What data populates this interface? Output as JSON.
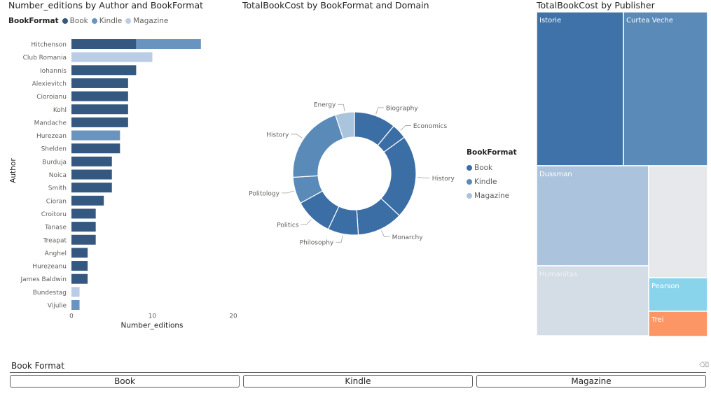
{
  "colors": {
    "book": "#34587f",
    "kindle": "#6a94c0",
    "magazine": "#bbcde4",
    "tm_light": "#e6e8eb",
    "tm_pearson": "#8ad4eb",
    "tm_trei": "#fd9665"
  },
  "bar_chart": {
    "title": "Number_editions by Author and BookFormat",
    "legend_title": "BookFormat",
    "legend_items": [
      "Book",
      "Kindle",
      "Magazine"
    ],
    "xlabel": "Number_editions",
    "ylabel": "Author"
  },
  "donut_chart": {
    "title": "TotalBookCost by BookFormat and Domain",
    "legend_title": "BookFormat",
    "legend_items": [
      "Book",
      "Kindle",
      "Magazine"
    ]
  },
  "treemap": {
    "title": "TotalBookCost by Publisher"
  },
  "slicer": {
    "title": "Book Format",
    "buttons": [
      "Book",
      "Kindle",
      "Magazine"
    ]
  },
  "chart_data": [
    {
      "type": "bar",
      "orientation": "horizontal",
      "stacked": true,
      "title": "Number_editions by Author and BookFormat",
      "xlabel": "Number_editions",
      "ylabel": "Author",
      "xlim": [
        0,
        20
      ],
      "xticks": [
        0,
        10,
        20
      ],
      "legend": "top-left",
      "categories": [
        "Hitchenson",
        "Club Romania",
        "Iohannis",
        "Alexievitch",
        "Cioroianu",
        "Kohl",
        "Mandache",
        "Hurezean",
        "Shelden",
        "Burduja",
        "Noica",
        "Smith",
        "Cioran",
        "Croitoru",
        "Tanase",
        "Treapat",
        "Anghel",
        "Hurezeanu",
        "James Baldwin",
        "Bundestag",
        "Vijulie"
      ],
      "series": [
        {
          "name": "Book",
          "values": [
            8,
            0,
            8,
            7,
            7,
            7,
            7,
            0,
            6,
            5,
            5,
            5,
            4,
            3,
            3,
            3,
            2,
            2,
            2,
            0,
            0
          ]
        },
        {
          "name": "Kindle",
          "values": [
            8,
            0,
            0,
            0,
            0,
            0,
            0,
            6,
            0,
            0,
            0,
            0,
            0,
            0,
            0,
            0,
            0,
            0,
            0,
            0,
            1
          ]
        },
        {
          "name": "Magazine",
          "values": [
            0,
            10,
            0,
            0,
            0,
            0,
            0,
            0,
            0,
            0,
            0,
            0,
            0,
            0,
            0,
            0,
            0,
            0,
            0,
            1,
            0
          ]
        }
      ]
    },
    {
      "type": "pie",
      "donut": true,
      "title": "TotalBookCost by BookFormat and Domain",
      "legend": "right",
      "slices": [
        {
          "label": "Biography",
          "format": "Book",
          "value": 11
        },
        {
          "label": "Economics",
          "format": "Book",
          "value": 4
        },
        {
          "label": "History",
          "format": "Book",
          "value": 22
        },
        {
          "label": "Monarchy",
          "format": "Book",
          "value": 12
        },
        {
          "label": "Philosophy",
          "format": "Book",
          "value": 8
        },
        {
          "label": "Politics",
          "format": "Book",
          "value": 10
        },
        {
          "label": "Politology",
          "format": "Kindle",
          "value": 7
        },
        {
          "label": "History",
          "format": "Kindle",
          "value": 21
        },
        {
          "label": "Energy",
          "format": "Magazine",
          "value": 5
        }
      ]
    },
    {
      "type": "treemap",
      "title": "TotalBookCost by Publisher",
      "items": [
        {
          "label": "Istorie",
          "value": 15
        },
        {
          "label": "Curtea Veche",
          "value": 15
        },
        {
          "label": "Dussman",
          "value": 17
        },
        {
          "label": "Humanitas",
          "value": 11
        },
        {
          "label": "",
          "value": 14
        },
        {
          "label": "Pearson",
          "value": 3
        },
        {
          "label": "Trei",
          "value": 3
        }
      ]
    }
  ]
}
